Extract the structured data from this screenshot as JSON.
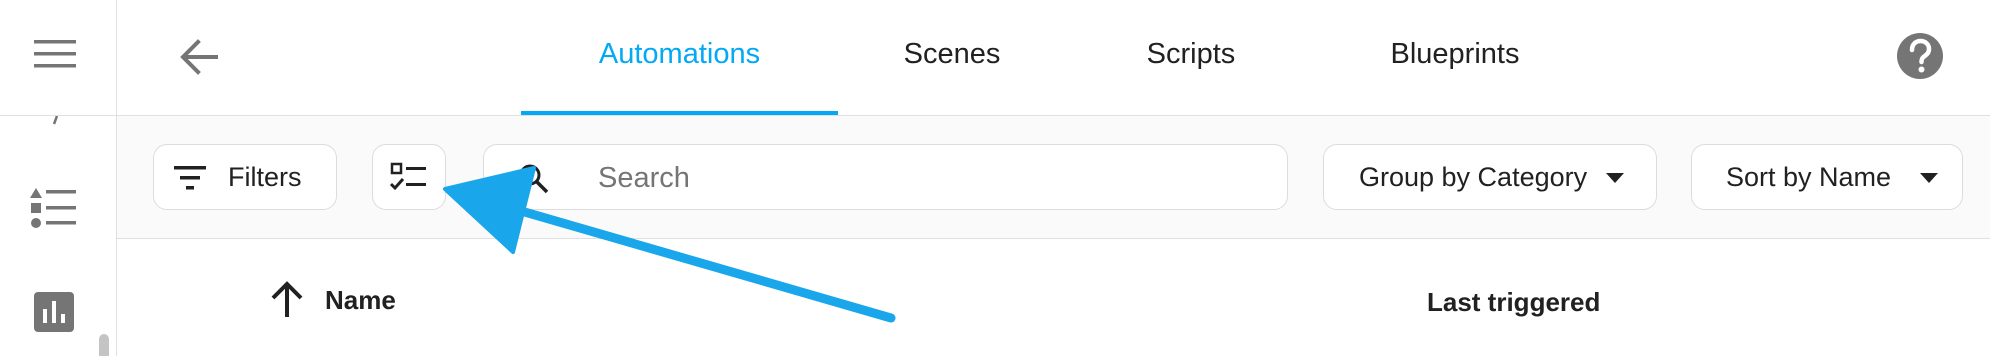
{
  "sidebar": {
    "items": [
      {
        "icon": "menu-icon"
      },
      {
        "icon": "list-icon"
      },
      {
        "icon": "bar-chart-icon"
      }
    ]
  },
  "topbar": {
    "tabs": [
      {
        "label": "Automations",
        "active": true
      },
      {
        "label": "Scenes",
        "active": false
      },
      {
        "label": "Scripts",
        "active": false
      },
      {
        "label": "Blueprints",
        "active": false
      }
    ],
    "help_icon": "help-icon",
    "back_icon": "back-arrow-icon"
  },
  "toolbar": {
    "filters_label": "Filters",
    "search_placeholder": "Search",
    "group_by_label": "Group by Category",
    "sort_by_label": "Sort by Name"
  },
  "table": {
    "columns": [
      "Name",
      "Last triggered"
    ],
    "sort_icon": "arrow-up-icon"
  },
  "colors": {
    "accent": "#03a9f4",
    "annotation_arrow": "#1aa6ea",
    "icon_gray": "#757575"
  }
}
